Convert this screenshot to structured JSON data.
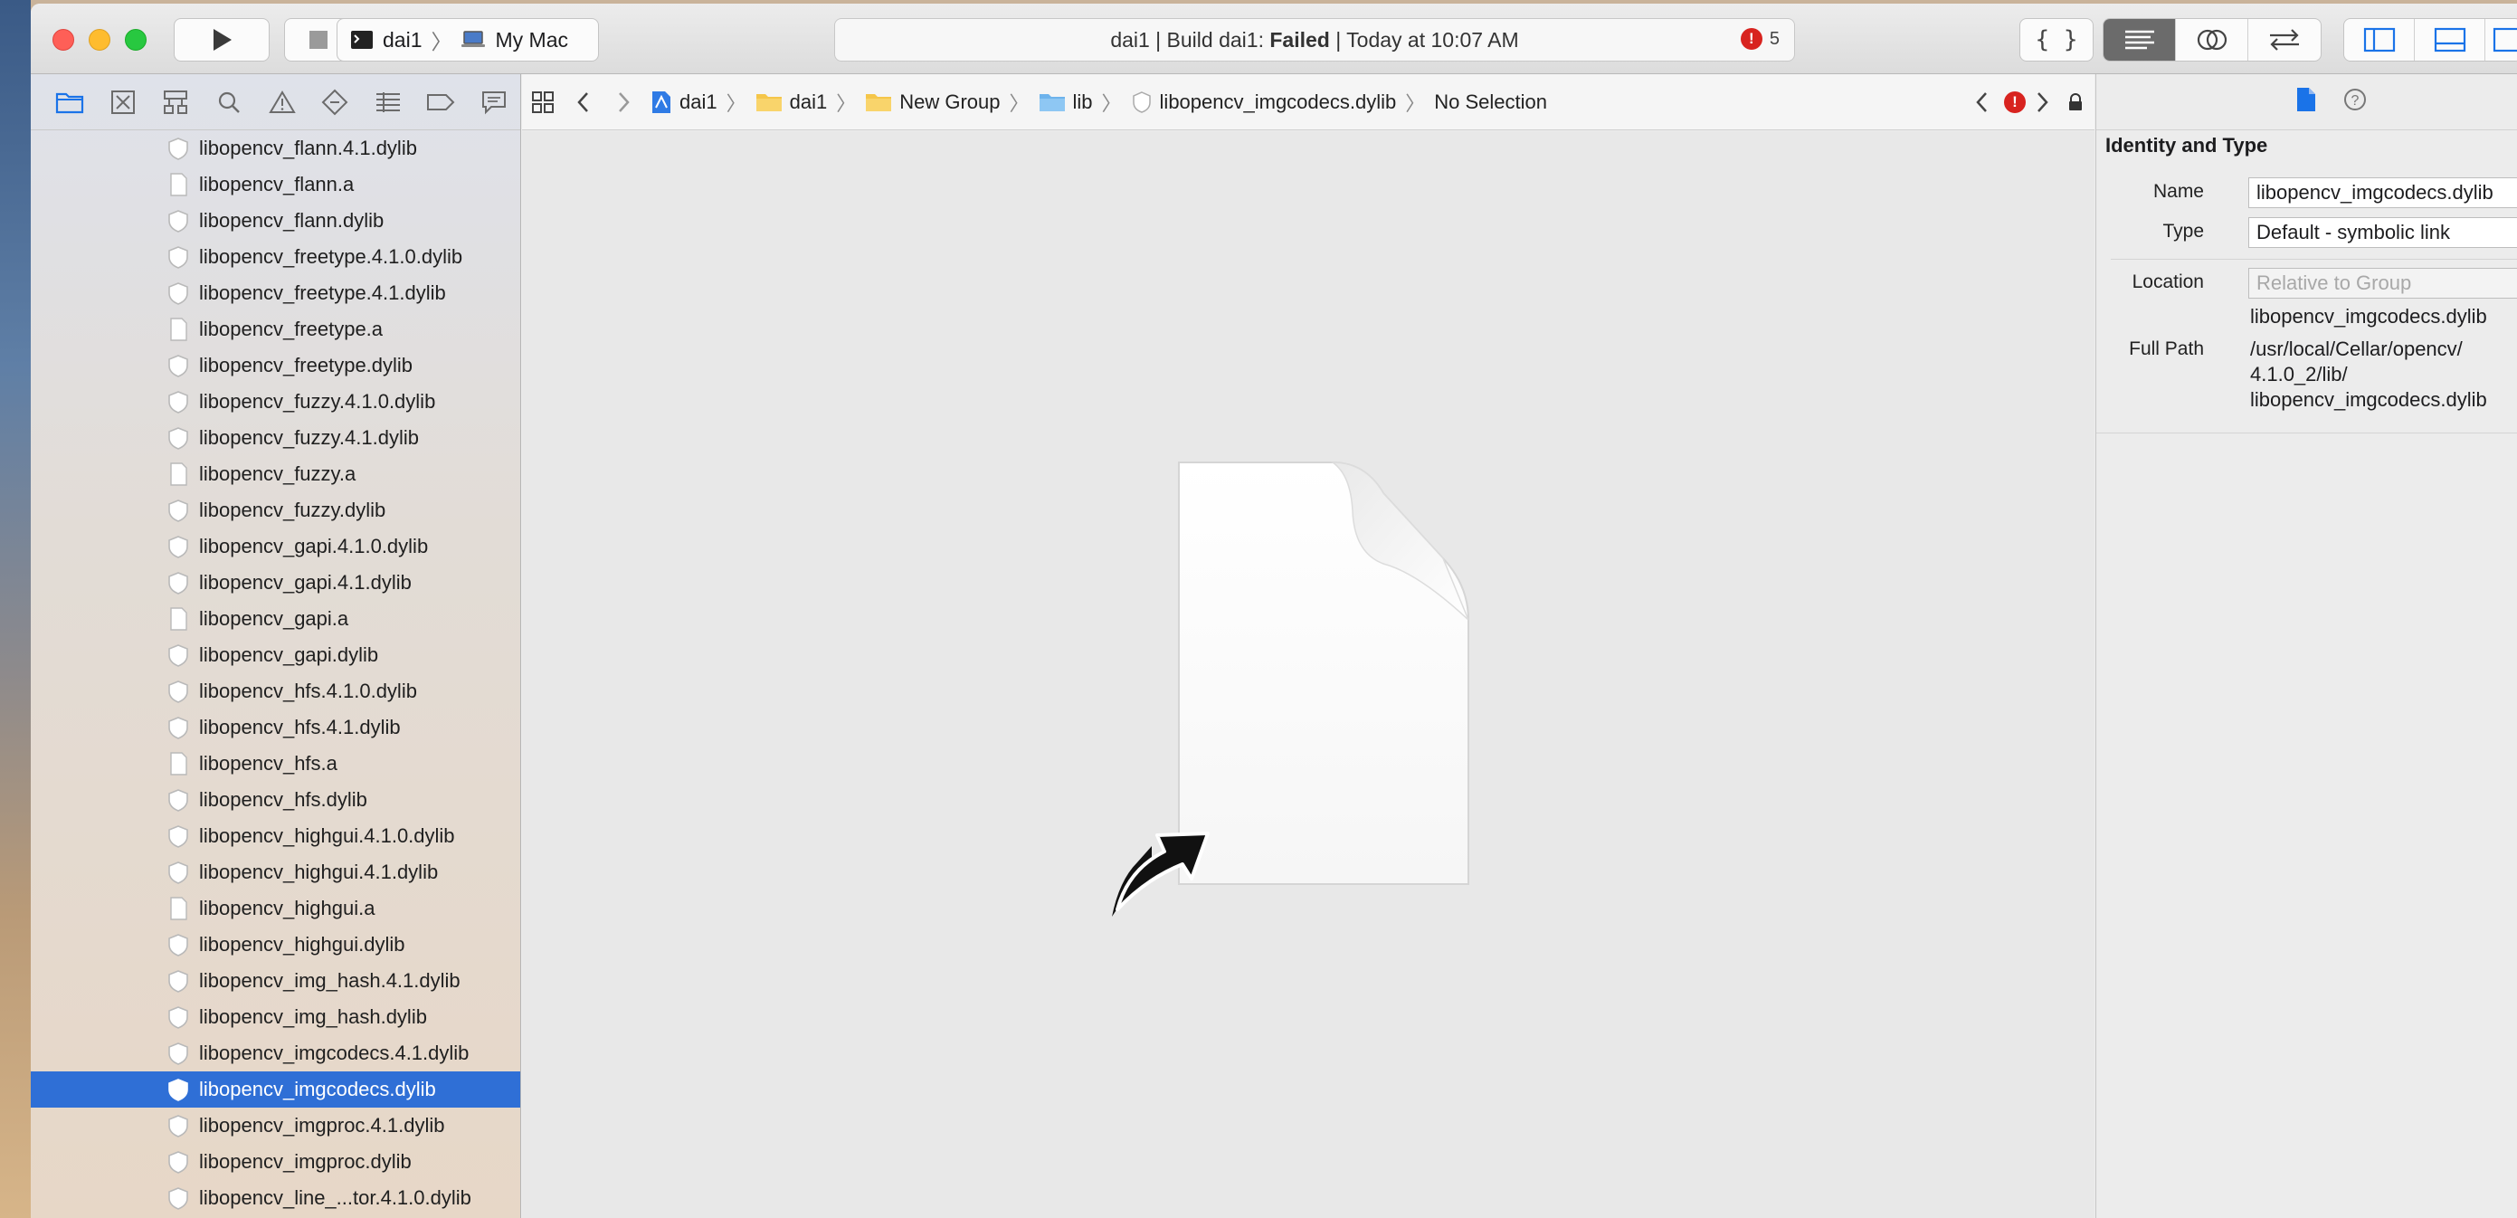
{
  "toolbar": {
    "scheme_target": "dai1",
    "scheme_destination": "My Mac",
    "status_prefix": "dai1 | Build dai1: ",
    "status_result": "Failed",
    "status_suffix": " | Today at 10:07 AM",
    "error_count": "5"
  },
  "navigator": {
    "tabs": [
      "folder-icon",
      "x-box-icon",
      "hierarchy-icon",
      "magnifier-icon",
      "warning-icon",
      "diamond-icon",
      "list-icon",
      "tag-icon",
      "speech-bubble-icon"
    ],
    "files": [
      {
        "name": "libopencv_flann.4.1.dylib",
        "kind": "dylib"
      },
      {
        "name": "libopencv_flann.a",
        "kind": "archive"
      },
      {
        "name": "libopencv_flann.dylib",
        "kind": "dylib"
      },
      {
        "name": "libopencv_freetype.4.1.0.dylib",
        "kind": "dylib"
      },
      {
        "name": "libopencv_freetype.4.1.dylib",
        "kind": "dylib"
      },
      {
        "name": "libopencv_freetype.a",
        "kind": "archive"
      },
      {
        "name": "libopencv_freetype.dylib",
        "kind": "dylib"
      },
      {
        "name": "libopencv_fuzzy.4.1.0.dylib",
        "kind": "dylib"
      },
      {
        "name": "libopencv_fuzzy.4.1.dylib",
        "kind": "dylib"
      },
      {
        "name": "libopencv_fuzzy.a",
        "kind": "archive"
      },
      {
        "name": "libopencv_fuzzy.dylib",
        "kind": "dylib"
      },
      {
        "name": "libopencv_gapi.4.1.0.dylib",
        "kind": "dylib"
      },
      {
        "name": "libopencv_gapi.4.1.dylib",
        "kind": "dylib"
      },
      {
        "name": "libopencv_gapi.a",
        "kind": "archive"
      },
      {
        "name": "libopencv_gapi.dylib",
        "kind": "dylib"
      },
      {
        "name": "libopencv_hfs.4.1.0.dylib",
        "kind": "dylib"
      },
      {
        "name": "libopencv_hfs.4.1.dylib",
        "kind": "dylib"
      },
      {
        "name": "libopencv_hfs.a",
        "kind": "archive"
      },
      {
        "name": "libopencv_hfs.dylib",
        "kind": "dylib"
      },
      {
        "name": "libopencv_highgui.4.1.0.dylib",
        "kind": "dylib"
      },
      {
        "name": "libopencv_highgui.4.1.dylib",
        "kind": "dylib"
      },
      {
        "name": "libopencv_highgui.a",
        "kind": "archive"
      },
      {
        "name": "libopencv_highgui.dylib",
        "kind": "dylib"
      },
      {
        "name": "libopencv_img_hash.4.1.dylib",
        "kind": "dylib"
      },
      {
        "name": "libopencv_img_hash.dylib",
        "kind": "dylib"
      },
      {
        "name": "libopencv_imgcodecs.4.1.dylib",
        "kind": "dylib"
      },
      {
        "name": "libopencv_imgcodecs.dylib",
        "kind": "dylib",
        "selected": true
      },
      {
        "name": "libopencv_imgproc.4.1.dylib",
        "kind": "dylib"
      },
      {
        "name": "libopencv_imgproc.dylib",
        "kind": "dylib"
      },
      {
        "name": "libopencv_line_...tor.4.1.0.dylib",
        "kind": "dylib"
      }
    ]
  },
  "jumpbar": {
    "crumbs": [
      {
        "label": "dai1",
        "icon": "project-icon"
      },
      {
        "label": "dai1",
        "icon": "folder-icon"
      },
      {
        "label": "New Group",
        "icon": "folder-icon"
      },
      {
        "label": "lib",
        "icon": "blue-folder-icon"
      },
      {
        "label": "libopencv_imgcodecs.dylib",
        "icon": "dylib-icon"
      },
      {
        "label": "No Selection",
        "icon": ""
      }
    ]
  },
  "inspector": {
    "section_title": "Identity and Type",
    "name_label": "Name",
    "name_value": "libopencv_imgcodecs.dylib",
    "type_label": "Type",
    "type_value": "Default - symbolic link",
    "location_label": "Location",
    "location_value": "Relative to Group",
    "location_file": "libopencv_imgcodecs.dylib",
    "fullpath_label": "Full Path",
    "fullpath_lines": [
      "/usr/local/Cellar/opencv/",
      "4.1.0_2/lib/",
      "libopencv_imgcodecs.dylib"
    ]
  },
  "colors": {
    "selection": "#2f6fd6",
    "error": "#d8231f",
    "accent_blue": "#1a73e8"
  }
}
